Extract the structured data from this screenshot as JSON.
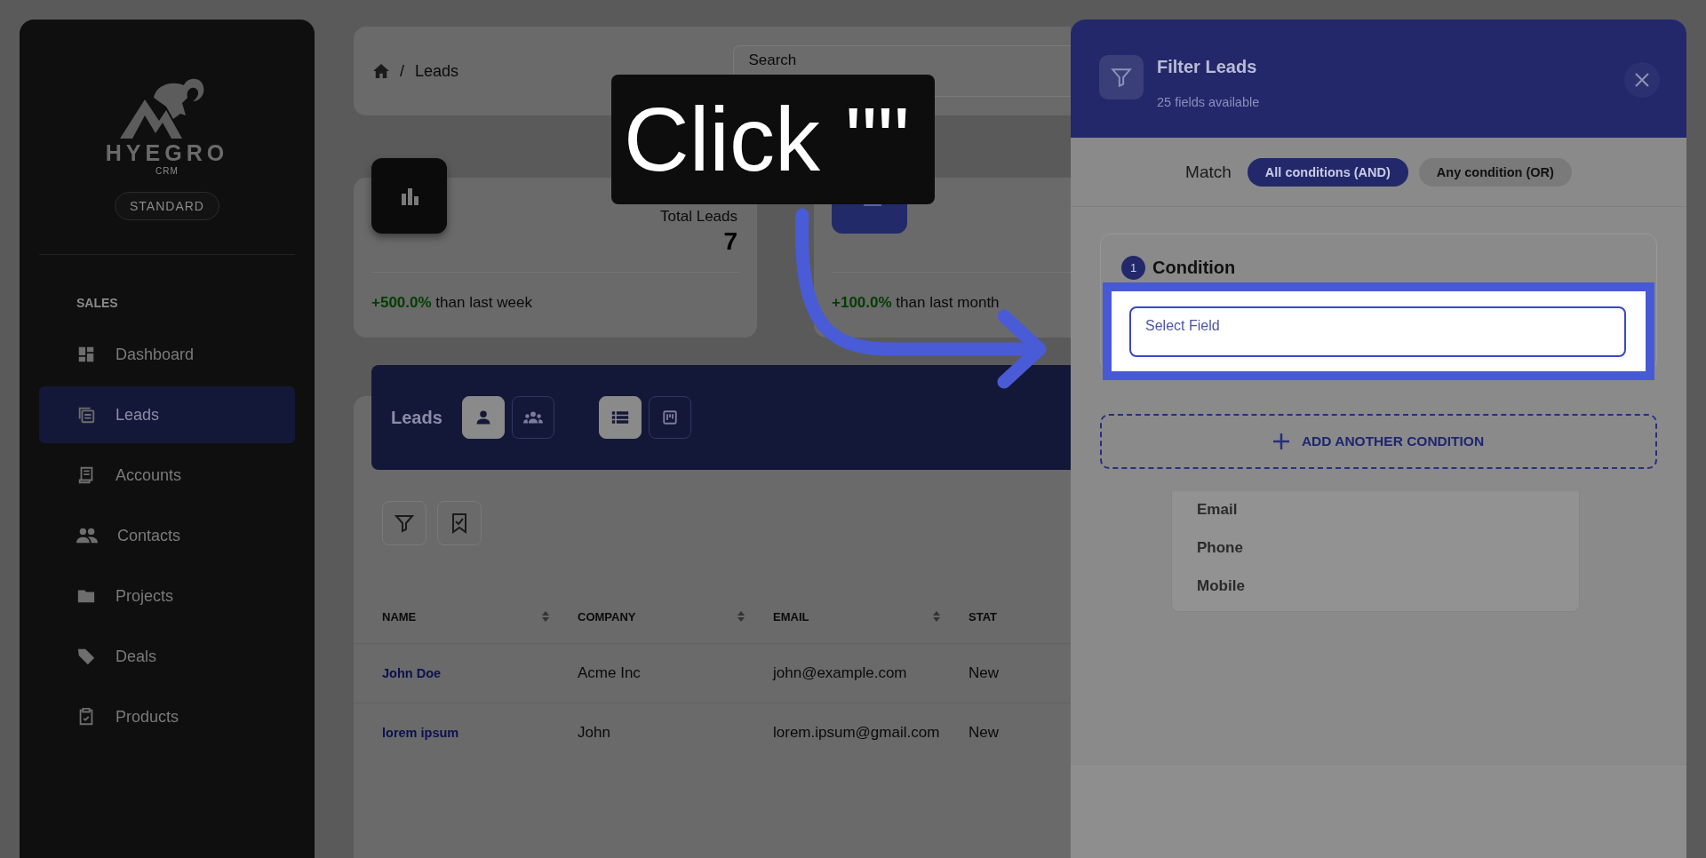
{
  "sidebar": {
    "brand": "HYEGRO",
    "brand_sub": "CRM",
    "plan": "STANDARD",
    "section": "SALES",
    "items": [
      {
        "label": "Dashboard",
        "selected": false
      },
      {
        "label": "Leads",
        "selected": true
      },
      {
        "label": "Accounts",
        "selected": false
      },
      {
        "label": "Contacts",
        "selected": false
      },
      {
        "label": "Projects",
        "selected": false
      },
      {
        "label": "Deals",
        "selected": false
      },
      {
        "label": "Products",
        "selected": false
      }
    ]
  },
  "breadcrumb": {
    "separator": "/",
    "items": [
      "Leads"
    ]
  },
  "search": {
    "placeholder": "Search"
  },
  "stats": [
    {
      "label": "Total Leads",
      "value": "7",
      "change": "+500.0%",
      "period": "than last week"
    },
    {
      "change": "+100.0%",
      "period": "than last month"
    }
  ],
  "leads_bar": {
    "title": "Leads",
    "view_buttons": [
      {
        "selected": true
      },
      {
        "selected": false
      }
    ],
    "layout_buttons": [
      {
        "selected": true
      },
      {
        "selected": false
      }
    ]
  },
  "table": {
    "columns": [
      "NAME",
      "COMPANY",
      "EMAIL",
      "STAT"
    ],
    "rows": [
      [
        "John Doe",
        "Acme Inc",
        "john@example.com",
        "New"
      ],
      [
        "lorem ipsum",
        "John",
        "lorem.ipsum@gmail.com",
        "New"
      ]
    ]
  },
  "filter_panel": {
    "title": "Filter Leads",
    "subtitle": "25 fields available",
    "match_label": "Match",
    "match_options": [
      {
        "label": "All conditions (AND)",
        "selected": true
      },
      {
        "label": "Any condition (OR)",
        "selected": false
      }
    ],
    "conditions": [
      {
        "number": "1",
        "title": "Condition",
        "field_placeholder": "Select Field",
        "highlighted": true
      }
    ],
    "field_options": [
      "Email",
      "Phone",
      "Mobile"
    ],
    "add_button": "ADD ANOTHER CONDITION"
  },
  "callout": {
    "text": "Click \"\""
  }
}
